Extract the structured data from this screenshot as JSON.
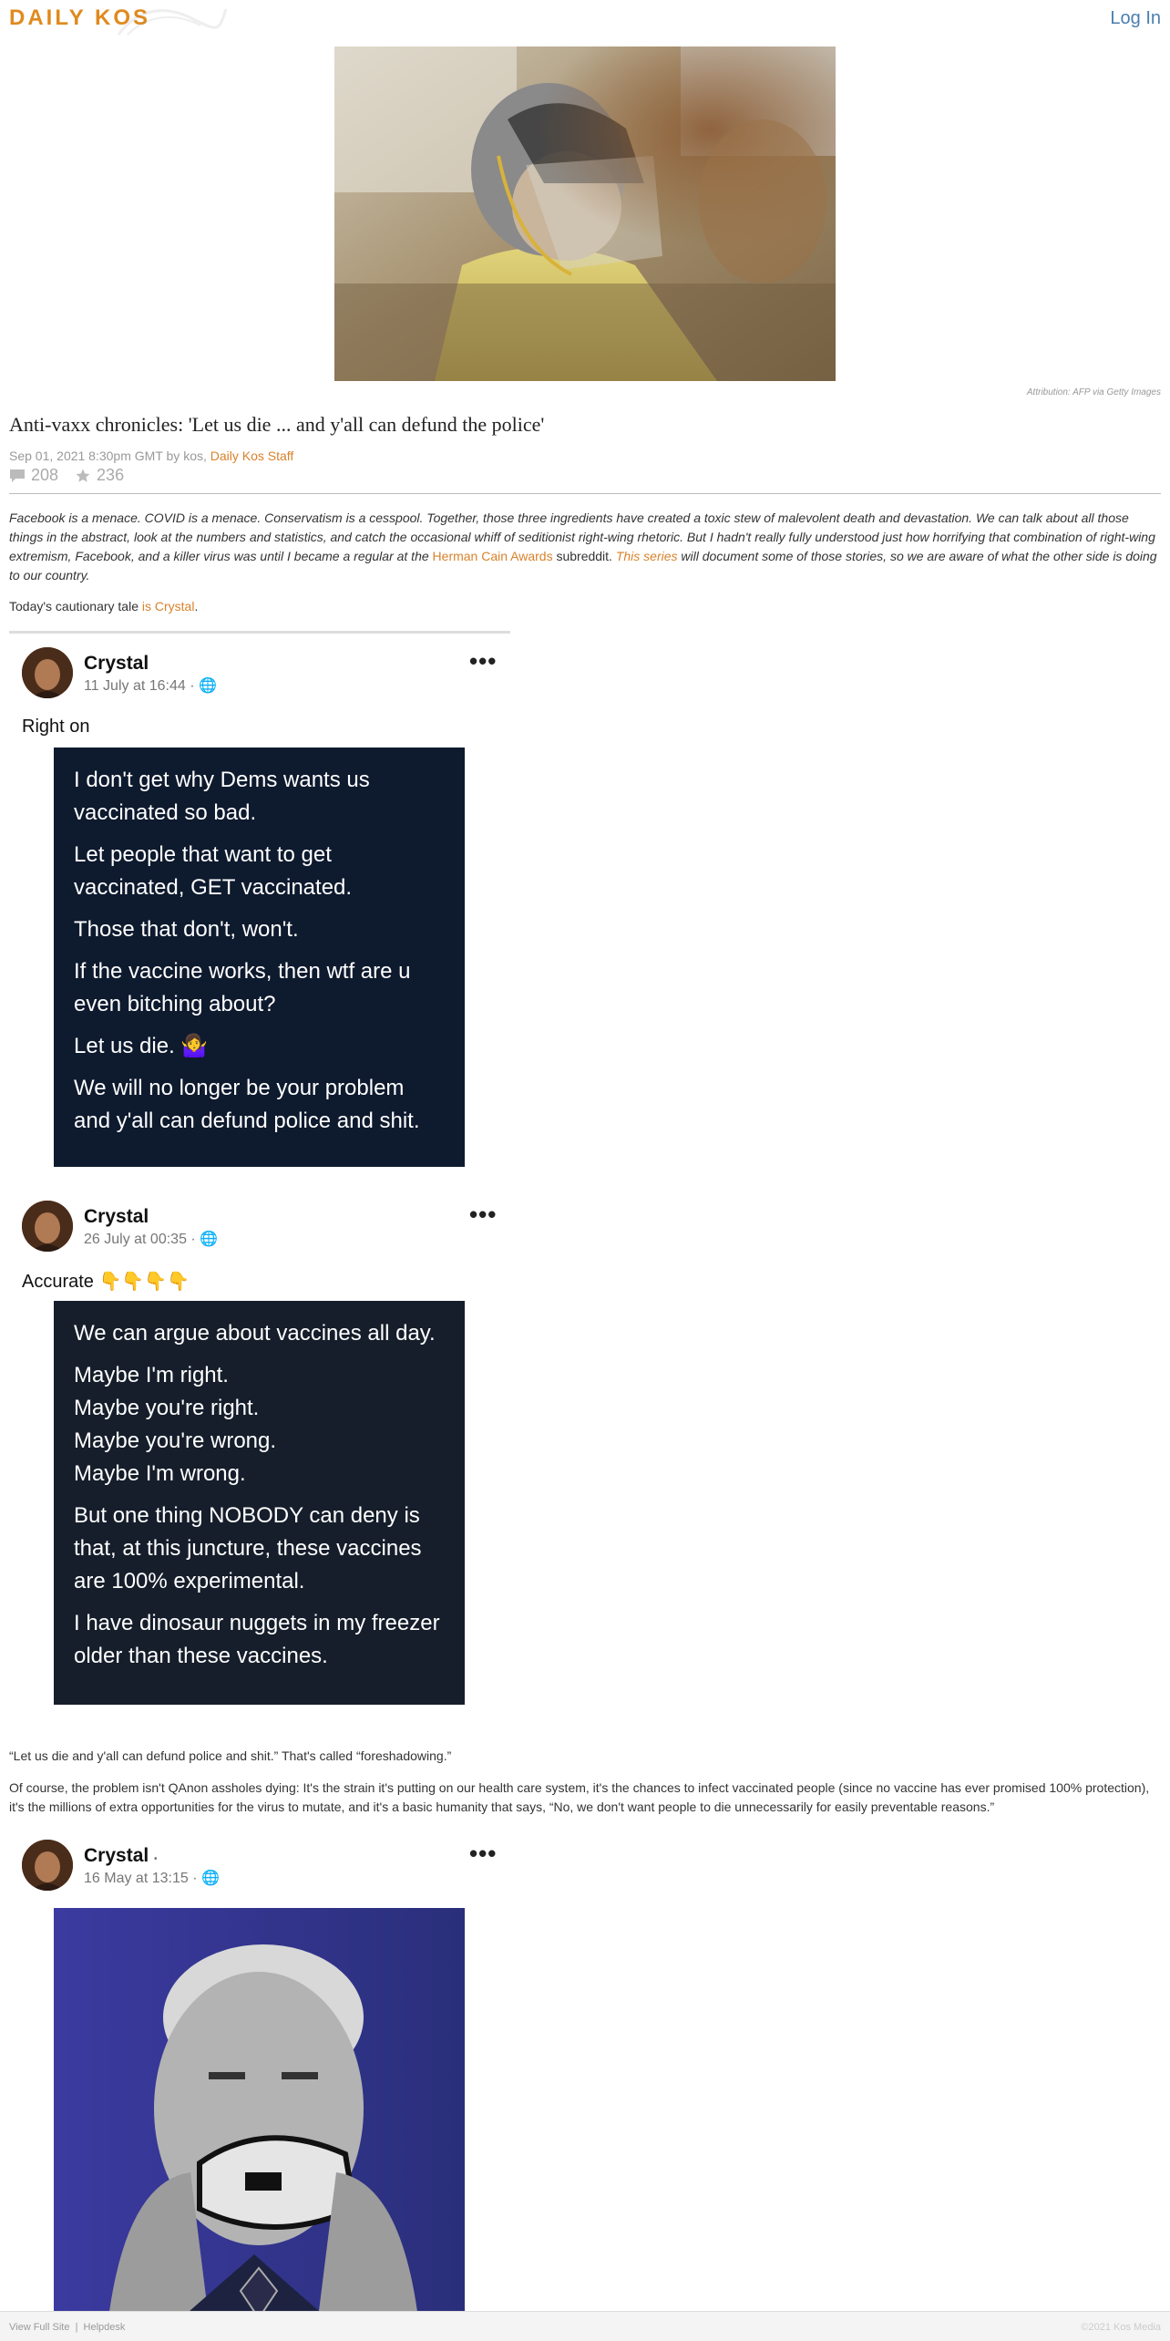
{
  "header": {
    "logo": "DAILY KOS",
    "login": "Log In"
  },
  "hero": {
    "attribution": "Attribution: AFP via Getty Images"
  },
  "article": {
    "title": "Anti-vaxx chronicles: 'Let us die ... and y'all can defund the police'",
    "byline_prefix": "Sep 01, 2021 8:30pm GMT by kos,",
    "byline_org": "Daily Kos Staff",
    "comments": "208",
    "recommends": "236",
    "lede_1": "Facebook is a menace. COVID is a menace. Conservatism is a cesspool. Together, those three ingredients have created a toxic stew of malevolent death and devastation. We can talk about all those things in the abstract, look at the numbers and statistics, and catch the occasional whiff of seditionist right-wing rhetoric. But I hadn't really fully understood just how horrifying that combination of right-wing extremism, Facebook, and a killer virus was until I became a regular at the",
    "lede_link_1": "Herman Cain Awards",
    "lede_2": " subreddit. ",
    "lede_link_2": "This series",
    "lede_3": " will document some of those stories, so we are aware of what the other side is doing to our country.",
    "today_prefix": "Today's cautionary tale ",
    "today_link": "is Crystal",
    "today_suffix": ".",
    "para_1": "“Let us die and y'all can defund police and shit.” That's called “foreshadowing.”",
    "para_2": "Of course, the problem isn't QAnon assholes dying: It's the strain it's putting on our health care system, it's the chances to infect vaccinated people (since no vaccine has ever promised 100% protection), it's the millions of extra opportunities for the virus to mutate, and it's a basic humanity that says, “No, we don't want people to die unnecessarily for easily preventable reasons.”"
  },
  "posts": [
    {
      "name": "Crystal",
      "date": "11 July at 16:44 ·",
      "text": "Right on",
      "card_bg": "#0e1a2e",
      "card_lines": [
        "I don't get why Dems wants us vaccinated so bad.",
        "Let people that want to get vaccinated, GET vaccinated.",
        "Those that don't, won't.",
        "If the vaccine works, then wtf are u even bitching about?",
        "Let us die. 🤷‍♀️",
        "We will no longer be your problem and y'all can defund police and shit."
      ]
    },
    {
      "name": "Crystal",
      "date": "26 July at 00:35 ·",
      "text": "Accurate 👇👇👇👇",
      "card_bg": "#161e2b",
      "card_lines": [
        "We can argue about vaccines all day.",
        "Maybe I'm right.",
        "Maybe you're right.",
        "Maybe you're wrong.",
        "Maybe I'm wrong.",
        "But one thing NOBODY can deny is that, at this juncture, these vaccines are 100% experimental.",
        "I have dinosaur nuggets in my freezer older than these vaccines."
      ]
    },
    {
      "name": "Crystal",
      "name_suffix": "•",
      "date": "16 May at 13:15 ·"
    }
  ],
  "footer": {
    "view_full": "View Full Site",
    "sep": "|",
    "helpdesk": "Helpdesk",
    "copyright": "©2021 Kos Media"
  }
}
